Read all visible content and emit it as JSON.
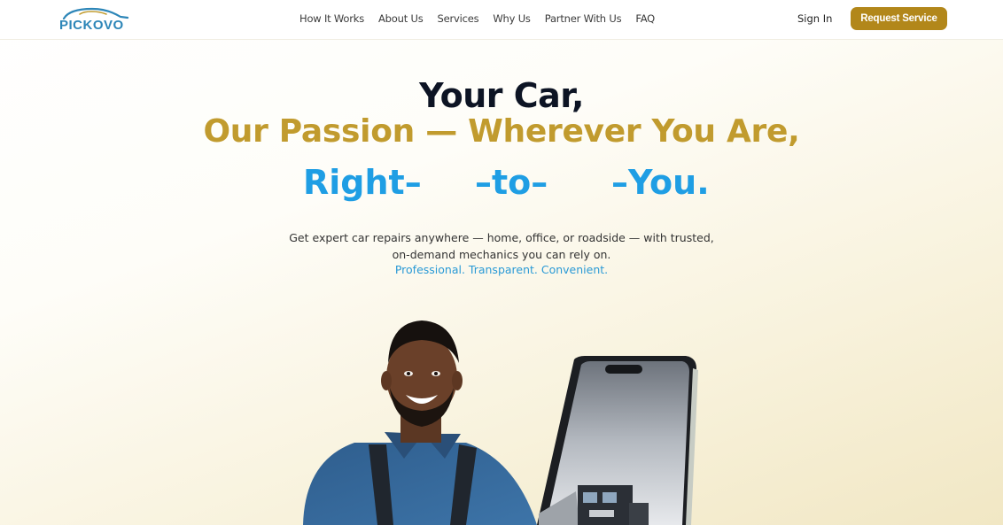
{
  "brand": {
    "logo_text": "PICKOVO"
  },
  "nav": {
    "items": [
      {
        "label": "How It Works"
      },
      {
        "label": "About Us"
      },
      {
        "label": "Services"
      },
      {
        "label": "Why Us"
      },
      {
        "label": "Partner With Us"
      },
      {
        "label": "FAQ"
      }
    ]
  },
  "header": {
    "signin_label": "Sign In",
    "cta_label": "Request Service"
  },
  "hero": {
    "line1": "Your Car,",
    "line2": "Our Passion — Wherever You Are,",
    "line3_words": [
      "Right–",
      "–to–",
      "–You."
    ],
    "subtitle": "Get expert car repairs anywhere — home, office, or roadside — with trusted, on-demand mechanics you can rely on.",
    "tagline": "Professional. Transparent. Convenient."
  },
  "colors": {
    "brand_gold": "#b2871a",
    "headline_gold": "#c19b2e",
    "accent_blue": "#1f9ee4",
    "navy": "#0d1424"
  },
  "icons": [
    "car-logo-icon",
    "mechanic-illustration",
    "phone-illustration",
    "truck-illustration"
  ]
}
